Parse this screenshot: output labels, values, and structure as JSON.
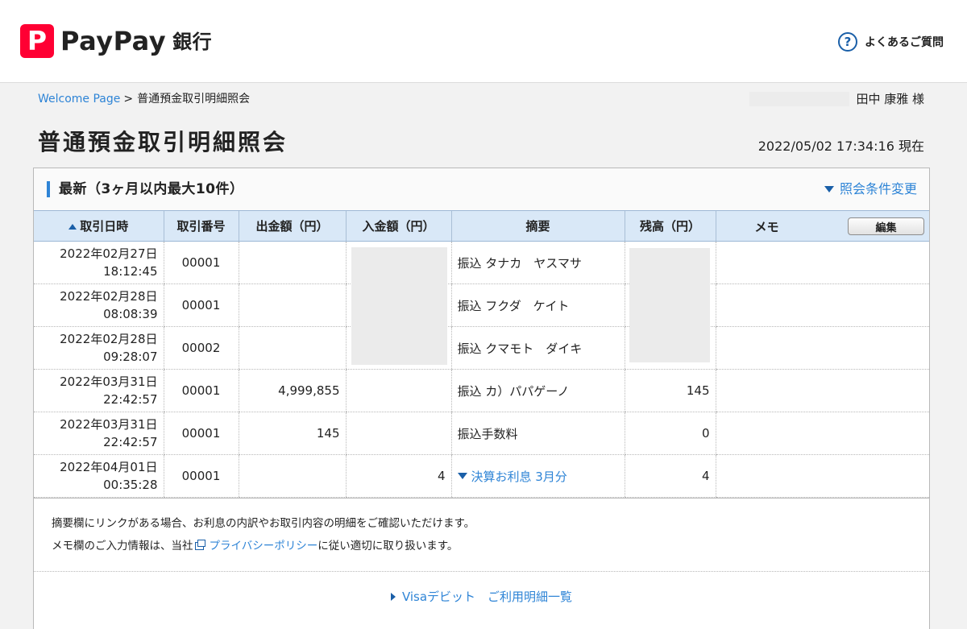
{
  "header": {
    "brand_mark": "P",
    "brand_name": "PayPay",
    "brand_suffix": "銀行",
    "faq_icon": "?",
    "faq_label": "よくあるご質問"
  },
  "breadcrumb": {
    "home": "Welcome Page",
    "separator": ">",
    "current": "普通預金取引明細照会"
  },
  "user": {
    "name": "田中 康雅 様"
  },
  "page": {
    "title": "普通預金取引明細照会",
    "timestamp": "2022/05/02 17:34:16 現在"
  },
  "panel": {
    "title": "最新（3ヶ月以内最大10件）",
    "change_link": "照会条件変更"
  },
  "table": {
    "headers": {
      "date": "取引日時",
      "number": "取引番号",
      "debit": "出金額（円）",
      "credit": "入金額（円）",
      "description": "摘要",
      "balance": "残高（円）",
      "memo": "メモ",
      "edit": "編集"
    },
    "rows": [
      {
        "date": "2022年02月27日",
        "time": "18:12:45",
        "number": "00001",
        "debit": "",
        "credit": "",
        "description": "振込 タナカ　ヤスマサ",
        "balance": "",
        "memo": ""
      },
      {
        "date": "2022年02月28日",
        "time": "08:08:39",
        "number": "00001",
        "debit": "",
        "credit": "",
        "description": "振込 フクダ　ケイト",
        "balance": "",
        "memo": ""
      },
      {
        "date": "2022年02月28日",
        "time": "09:28:07",
        "number": "00002",
        "debit": "",
        "credit": "",
        "description": "振込 クマモト　ダイキ",
        "balance": "",
        "memo": ""
      },
      {
        "date": "2022年03月31日",
        "time": "22:42:57",
        "number": "00001",
        "debit": "4,999,855",
        "credit": "",
        "description": "振込 カ）パパゲーノ",
        "balance": "145",
        "memo": ""
      },
      {
        "date": "2022年03月31日",
        "time": "22:42:57",
        "number": "00001",
        "debit": "145",
        "credit": "",
        "description": "振込手数料",
        "balance": "0",
        "memo": ""
      },
      {
        "date": "2022年04月01日",
        "time": "00:35:28",
        "number": "00001",
        "debit": "",
        "credit": "4",
        "description": "決算お利息 3月分",
        "balance": "4",
        "memo": ""
      }
    ]
  },
  "notes": {
    "line1": "摘要欄にリンクがある場合、お利息の内訳やお取引内容の明細をご確認いただけます。",
    "line2_prefix": "メモ欄のご入力情報は、当社",
    "line2_link": "プライバシーポリシー",
    "line2_suffix": "に従い適切に取り扱います。"
  },
  "visa": {
    "label": "Visaデビット　ご利用明細一覧"
  },
  "colors": {
    "brand_red": "#ff0033",
    "link_blue": "#2e84d6",
    "header_blue": "#d9e8f7"
  },
  "icons": {
    "faq": "question-circle-icon",
    "sort": "sort-up-icon",
    "expand": "triangle-down-icon",
    "external": "external-window-icon",
    "arrow": "triangle-right-icon"
  }
}
